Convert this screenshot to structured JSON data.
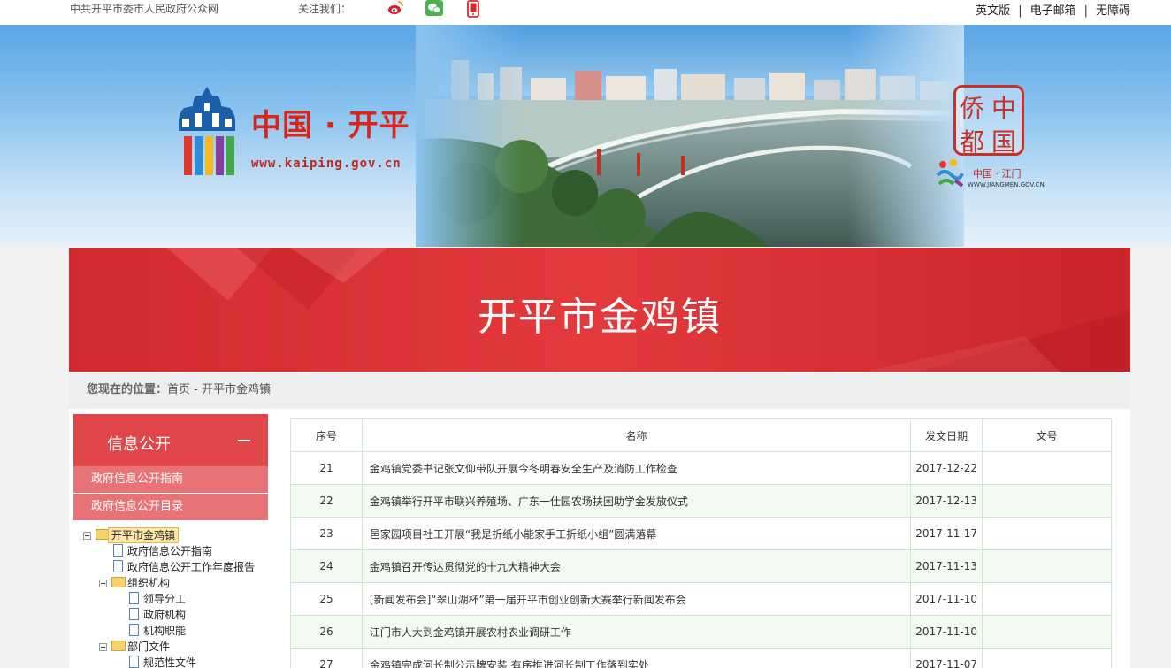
{
  "topbar": {
    "site_name": "中共开平市委市人民政府公众网",
    "follow_label": "关注我们：",
    "links": [
      "英文版",
      "电子邮箱",
      "无障碍"
    ]
  },
  "banner": {
    "logo_title": "中国 · 开平",
    "logo_url": "www.kaiping.gov.cn",
    "qiao_chars": [
      "侨",
      "中",
      "都",
      "国"
    ],
    "jiangmen_name": "中国 · 江门",
    "jiangmen_url": "WWW.JIANGMEN.GOV.CN"
  },
  "page_title": "开平市金鸡镇",
  "breadcrumb": {
    "label": "您现在的位置：",
    "home": "首页",
    "sep": " - ",
    "current": "开平市金鸡镇"
  },
  "sidebar": {
    "heading": "信息公开",
    "links": [
      "政府信息公开指南",
      "政府信息公开目录"
    ],
    "tree": [
      {
        "label": "开平市金鸡镇",
        "type": "folder",
        "level": 0,
        "selected": true,
        "toggle": true
      },
      {
        "label": "政府信息公开指南",
        "type": "doc",
        "level": 1
      },
      {
        "label": "政府信息公开工作年度报告",
        "type": "doc",
        "level": 1
      },
      {
        "label": "组织机构",
        "type": "folder",
        "level": 1,
        "toggle": true
      },
      {
        "label": "领导分工",
        "type": "doc",
        "level": 2
      },
      {
        "label": "政府机构",
        "type": "doc",
        "level": 2
      },
      {
        "label": "机构职能",
        "type": "doc",
        "level": 2
      },
      {
        "label": "部门文件",
        "type": "folder",
        "level": 1,
        "toggle": true
      },
      {
        "label": "规范性文件",
        "type": "doc",
        "level": 2
      }
    ]
  },
  "table": {
    "headers": [
      "序号",
      "名称",
      "发文日期",
      "文号"
    ],
    "rows": [
      {
        "no": "21",
        "name": "金鸡镇党委书记张文仰带队开展今冬明春安全生产及消防工作检查",
        "date": "2017-12-22",
        "doc": ""
      },
      {
        "no": "22",
        "name": "金鸡镇举行开平市联兴养殖场、广东一仕园农场扶困助学金发放仪式",
        "date": "2017-12-13",
        "doc": ""
      },
      {
        "no": "23",
        "name": "邑家园项目社工开展“我是折纸小能家手工折纸小组”圆满落幕",
        "date": "2017-11-17",
        "doc": ""
      },
      {
        "no": "24",
        "name": "金鸡镇召开传达贯彻党的十九大精神大会",
        "date": "2017-11-13",
        "doc": ""
      },
      {
        "no": "25",
        "name": "[新闻发布会]“翠山湖杯”第一届开平市创业创新大赛举行新闻发布会",
        "date": "2017-11-10",
        "doc": ""
      },
      {
        "no": "26",
        "name": "江门市人大到金鸡镇开展农村农业调研工作",
        "date": "2017-11-10",
        "doc": ""
      },
      {
        "no": "27",
        "name": "金鸡镇完成河长制公示牌安装 有序推进河长制工作落到实处",
        "date": "2017-11-07",
        "doc": ""
      }
    ]
  },
  "colors": {
    "brand_red": "#d9251c",
    "title_bar": "#e23a3d",
    "sidebar_head": "#e0464a",
    "sidebar_link": "#e87377",
    "table_border": "#cfe6cf",
    "row_alt": "#f2faf2"
  }
}
